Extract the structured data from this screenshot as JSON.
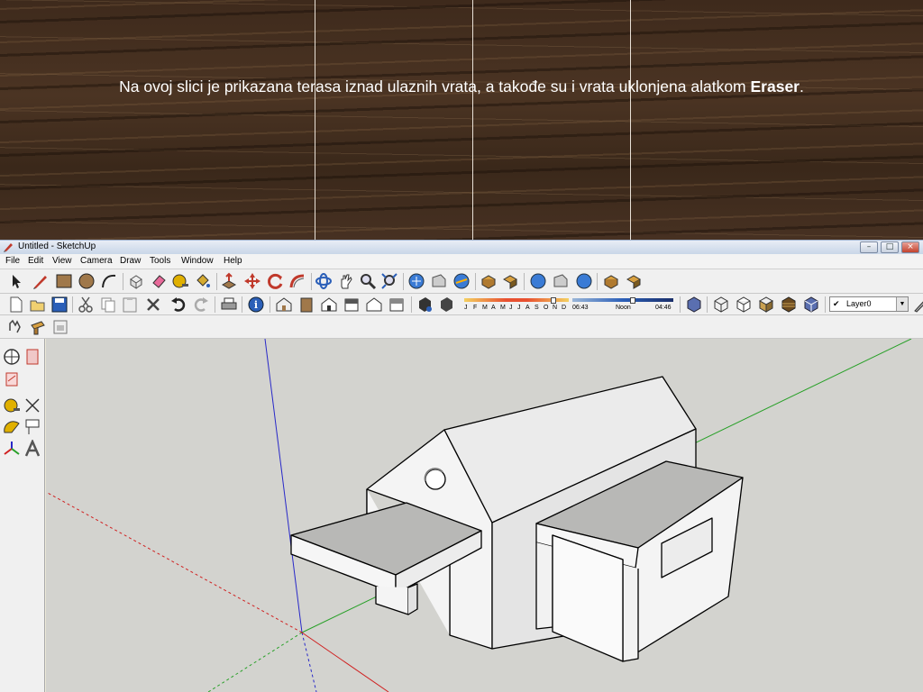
{
  "slide": {
    "caption_pre": "Na ovoj slici je prikazana terasa iznad ulaznih vrata, a takođe su i vrata uklonjena alatkom ",
    "caption_bold": "Eraser",
    "caption_post": "."
  },
  "window": {
    "title": "Untitled - SketchUp",
    "min": "–",
    "max": "□",
    "close": "×"
  },
  "menu": [
    "File",
    "Edit",
    "View",
    "Camera",
    "Draw",
    "Tools",
    "Window",
    "Help"
  ],
  "shadow_settings": {
    "months": [
      "J",
      "F",
      "M",
      "A",
      "M",
      "J",
      "J",
      "A",
      "S",
      "O",
      "N",
      "D"
    ],
    "time_start": "06:43",
    "time_mid": "Noon",
    "time_end": "04:46"
  },
  "layer": {
    "check": "✔",
    "name": "Layer0"
  },
  "colors": {
    "accent_blue": "#2b5fb8",
    "axis_red": "#d02020",
    "axis_green": "#28a028",
    "axis_blue": "#2828c8",
    "roof_gray": "#b8b8b6",
    "wall_white": "#f4f4f4"
  },
  "icons": {
    "toolbar_row1": [
      "select-icon",
      "pencil-icon",
      "rectangle-icon",
      "circle-icon",
      "arc-icon",
      "make-component-icon",
      "eraser-icon",
      "tape-measure-icon",
      "paint-bucket-icon",
      "push-pull-icon",
      "move-icon",
      "rotate-icon",
      "follow-me-icon",
      "orbit-icon",
      "pan-icon",
      "zoom-icon",
      "zoom-extents-icon",
      "get-models-icon",
      "share-model-icon",
      "get-photo-texture-icon",
      "add-location-icon",
      "toggle-terrain-icon"
    ],
    "toolbar_row2": [
      "new-icon",
      "open-icon",
      "save-icon",
      "cut-icon",
      "copy-icon",
      "paste-icon",
      "delete-icon",
      "undo-icon",
      "redo-icon",
      "print-icon",
      "model-info-icon",
      "iso-view-icon",
      "top-view-icon",
      "front-view-icon",
      "right-view-icon",
      "back-view-icon",
      "left-view-icon",
      "shadow-dialog-icon",
      "display-shadows-icon",
      "xray-icon",
      "wireframe-icon",
      "hidden-line-icon",
      "shaded-icon",
      "shaded-textures-icon",
      "monochrome-icon"
    ]
  }
}
